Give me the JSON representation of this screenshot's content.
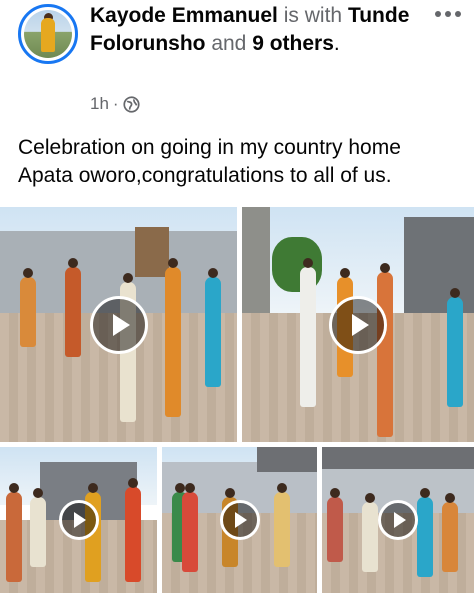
{
  "post": {
    "author": "Kayode Emmanuel",
    "with_text": "is with",
    "tagged": "Tunde Folorunsho",
    "and_text": "and",
    "others": "9 others",
    "period": ".",
    "time": "1h",
    "separator": "·",
    "privacy_icon": "globe-icon",
    "text_line1": "Celebration on going in my country home",
    "text_line2": "Apata oworo,congratulations to all of us."
  },
  "media": {
    "videos": [
      {
        "label": "video-1",
        "icon": "play-icon"
      },
      {
        "label": "video-2",
        "icon": "play-icon"
      },
      {
        "label": "video-3",
        "icon": "play-icon"
      },
      {
        "label": "video-4",
        "icon": "play-icon"
      },
      {
        "label": "video-5",
        "icon": "play-icon"
      }
    ]
  },
  "colors": {
    "accent": "#1877f2",
    "muted_text": "#65676b",
    "text": "#050505"
  }
}
